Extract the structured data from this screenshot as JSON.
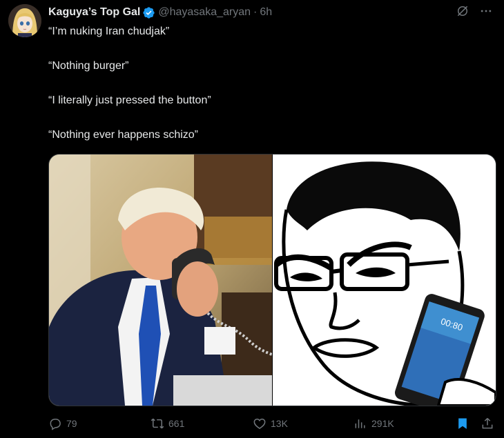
{
  "tweet": {
    "display_name": "Kaguya’s Top Gal",
    "handle": "@hayasaka_aryan",
    "separator": "·",
    "time": "6h",
    "lines": [
      "“I’m nuking Iran chudjak”",
      "“Nothing burger”",
      "“I literally just pressed the button”",
      "“Nothing ever happens schizo”"
    ]
  },
  "media": {
    "left_alt": "Man in suit and blue tie talking on a desk phone",
    "right_alt": "Line-drawn glasses wojak holding a smartphone",
    "phone_clock": "00:80"
  },
  "actions": {
    "replies": "79",
    "reposts": "661",
    "likes": "13K",
    "views": "291K"
  },
  "colors": {
    "background": "#000000",
    "text": "#e7e9ea",
    "muted": "#71767b",
    "verified": "#1d9bf0",
    "bookmark_active": "#1d9bf0"
  },
  "icons": [
    "verified-badge-icon",
    "grok-icon",
    "more-icon",
    "reply-icon",
    "repost-icon",
    "like-icon",
    "views-icon",
    "bookmark-icon",
    "share-icon"
  ]
}
